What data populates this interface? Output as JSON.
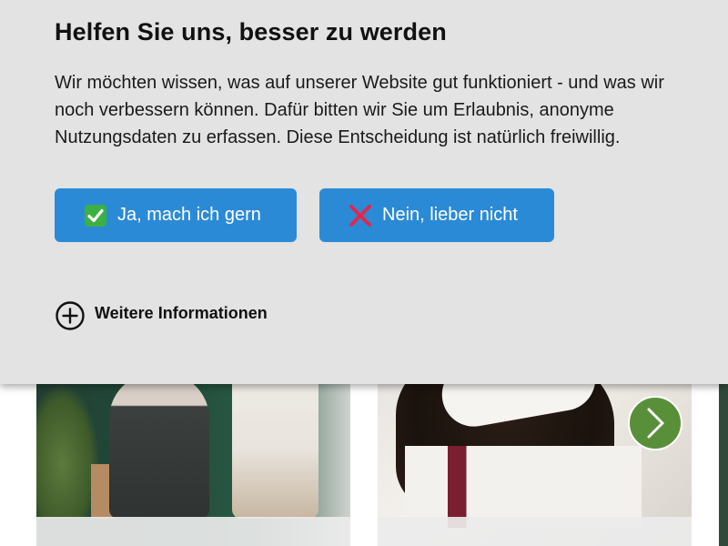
{
  "consent": {
    "title": "Helfen Sie uns, besser zu werden",
    "text": "Wir möchten wissen, was auf unserer Website gut funktioniert - und was wir noch verbessern können. Dafür bitten wir Sie um Erlaubnis, anonyme Nutzungsdaten zu erfassen. Diese Entscheidung ist natürlich freiwillig.",
    "accept_label": "Ja, mach ich gern",
    "decline_label": "Nein, lieber nicht",
    "more_info_label": "Weitere Informationen",
    "accept_icon": "check-mark-icon",
    "decline_icon": "cross-mark-icon",
    "more_info_icon": "plus-circle-icon"
  },
  "colors": {
    "banner_bg": "#e3e3e3",
    "button_bg": "#2b8ad6",
    "accept_icon_bg": "#3cb043",
    "decline_icon": "#e0284c",
    "slider_button": "#5a8f3a"
  },
  "slider": {
    "next_icon": "chevron-right-icon"
  }
}
